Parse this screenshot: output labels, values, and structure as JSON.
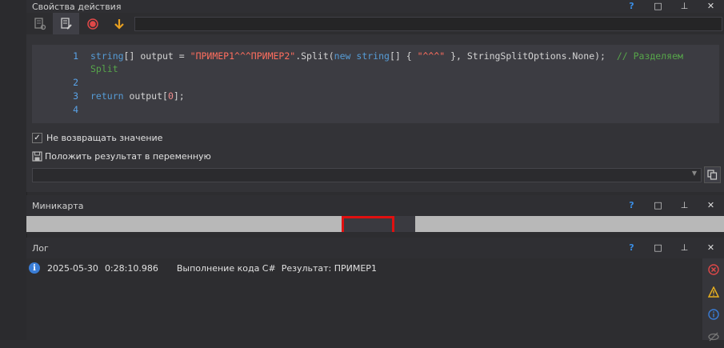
{
  "panels": {
    "properties": {
      "title": "Свойства действия"
    },
    "minimap": {
      "title": "Миникарта"
    },
    "log": {
      "title": "Лог"
    }
  },
  "window_buttons": {
    "help": "?",
    "maximize": "□",
    "pin": "⊥",
    "close": "✕"
  },
  "editor": {
    "lines": [
      {
        "n": "1",
        "parts": [
          {
            "t": "string",
            "c": "kw"
          },
          {
            "t": "[] output = ",
            "c": ""
          },
          {
            "t": "\"ПРИМЕР1^^^ПРИМЕР2\"",
            "c": "str"
          },
          {
            "t": ".Split(",
            "c": ""
          },
          {
            "t": "new",
            "c": "kw"
          },
          {
            "t": " ",
            "c": ""
          },
          {
            "t": "string",
            "c": "kw"
          },
          {
            "t": "[] { ",
            "c": ""
          },
          {
            "t": "\"^^^\"",
            "c": "str"
          },
          {
            "t": " }, StringSplitOptions.None);  ",
            "c": ""
          },
          {
            "t": "// Разделяем",
            "c": "cmt"
          }
        ]
      },
      {
        "n": "",
        "parts": [
          {
            "t": "Split",
            "c": "cmt"
          }
        ]
      },
      {
        "n": "2",
        "parts": []
      },
      {
        "n": "3",
        "parts": [
          {
            "t": "return",
            "c": "kw"
          },
          {
            "t": " output[",
            "c": ""
          },
          {
            "t": "0",
            "c": "num"
          },
          {
            "t": "];",
            "c": ""
          }
        ]
      },
      {
        "n": "4",
        "parts": []
      }
    ]
  },
  "options": {
    "no_return": {
      "label": "Не возвращать значение",
      "checked": true,
      "mark": "✓"
    },
    "store_result": {
      "label": "Положить результат в переменную"
    }
  },
  "result_variable": {
    "value": ""
  },
  "log": {
    "entries": [
      {
        "date": "2025-05-30",
        "time": "0:28:10.986",
        "message": "Выполнение кода C#  Результат: ПРИМЕР1",
        "icon": "i"
      }
    ]
  },
  "colors": {
    "accent": "#3a8ee6",
    "error": "#e04848",
    "warning": "#e8b020",
    "viewport": "#e01010"
  }
}
